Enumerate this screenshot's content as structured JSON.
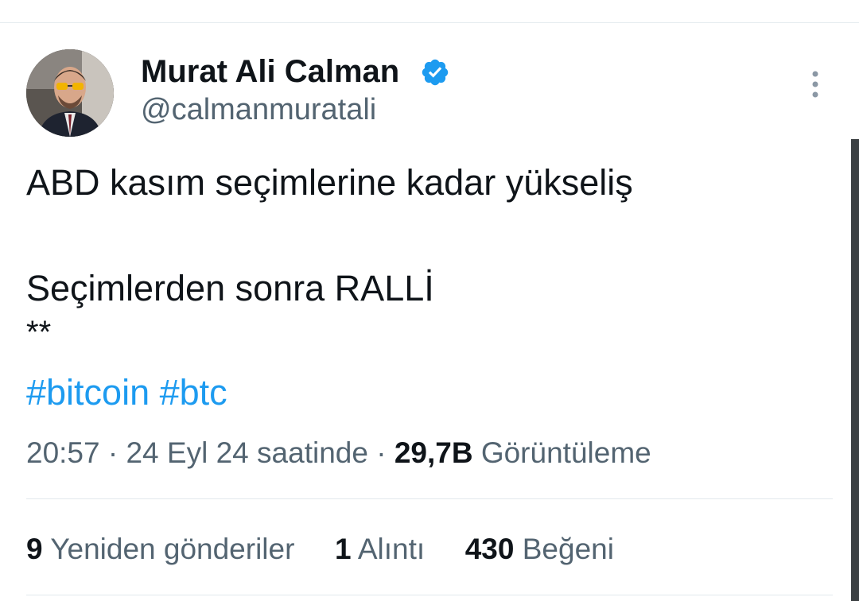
{
  "author": {
    "name": "Murat Ali Calman",
    "handle": "@calmanmuratali",
    "verified_icon": "verified-badge-icon",
    "accent_color": "#1d9bf0"
  },
  "tweet": {
    "line1": "ABD kasım seçimlerine kadar yükseliş",
    "line2": "Seçimlerden sonra RALLİ",
    "line3": "**",
    "hashtags": [
      "#bitcoin",
      "#btc"
    ]
  },
  "meta": {
    "time": "20:57",
    "separator": "·",
    "date": "24 Eyl 24 saatinde",
    "views_count": "29,7B",
    "views_label": "Görüntüleme"
  },
  "stats": {
    "reposts_count": "9",
    "reposts_label": "Yeniden gönderiler",
    "quotes_count": "1",
    "quotes_label": "Alıntı",
    "likes_count": "430",
    "likes_label": "Beğeni"
  },
  "colors": {
    "text": "#0f1419",
    "secondary": "#536471",
    "link": "#1d9bf0",
    "divider": "#e1e8ed"
  }
}
